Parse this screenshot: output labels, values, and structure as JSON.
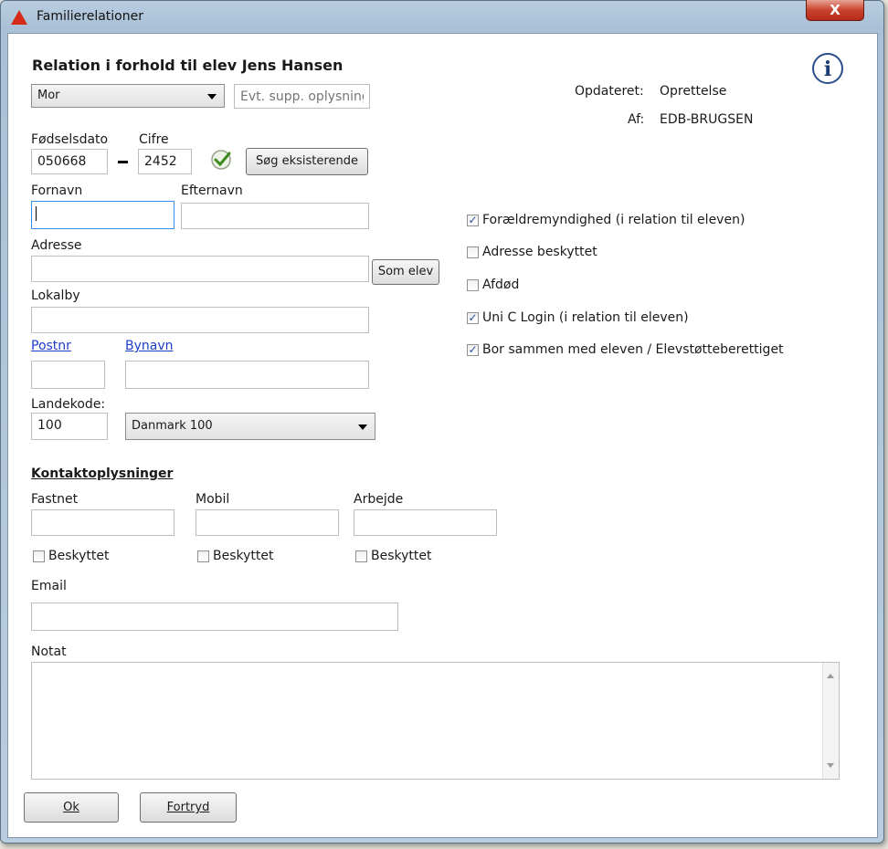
{
  "window": {
    "title": "Familierelationer",
    "close_label": "X"
  },
  "header": {
    "title": "Relation i forhold til elev Jens Hansen"
  },
  "relation": {
    "selected": "Mor",
    "supp_placeholder": "Evt. supp. oplysning"
  },
  "meta": {
    "updated_label": "Opdateret:",
    "updated_value": "Oprettelse",
    "by_label": "Af:",
    "by_value": "EDB-BRUGSEN"
  },
  "birth": {
    "dato_label": "Fødselsdato",
    "dato_value": "050668",
    "dash": "–",
    "cifre_label": "Cifre",
    "cifre_value": "2452",
    "search_button": "Søg eksisterende"
  },
  "name": {
    "fornavn_label": "Fornavn",
    "fornavn_value": "",
    "efternavn_label": "Efternavn",
    "efternavn_value": ""
  },
  "address": {
    "adresse_label": "Adresse",
    "adresse_value": "",
    "som_elev_button": "Som elev",
    "lokalby_label": "Lokalby",
    "lokalby_value": ""
  },
  "post": {
    "postnr_label": "Postnr",
    "postnr_value": "",
    "bynavn_label": "Bynavn",
    "bynavn_value": ""
  },
  "country": {
    "label": "Landekode:",
    "code": "100",
    "selected": "Danmark 100"
  },
  "checkboxes": [
    {
      "label": "Forældremyndighed (i relation til eleven)",
      "checked": true
    },
    {
      "label": "Adresse beskyttet",
      "checked": false
    },
    {
      "label": "Afdød",
      "checked": false
    },
    {
      "label": "Uni C Login (i relation til eleven)",
      "checked": true
    },
    {
      "label": "Bor sammen med eleven / Elevstøtteberettiget",
      "checked": true
    }
  ],
  "contact": {
    "heading": "Kontaktoplysninger",
    "fastnet_label": "Fastnet",
    "mobil_label": "Mobil",
    "arbejde_label": "Arbejde",
    "beskyttet_label": "Beskyttet",
    "email_label": "Email"
  },
  "notat": {
    "label": "Notat",
    "value": ""
  },
  "buttons": {
    "ok": "Ok",
    "fortryd": "Fortryd"
  }
}
